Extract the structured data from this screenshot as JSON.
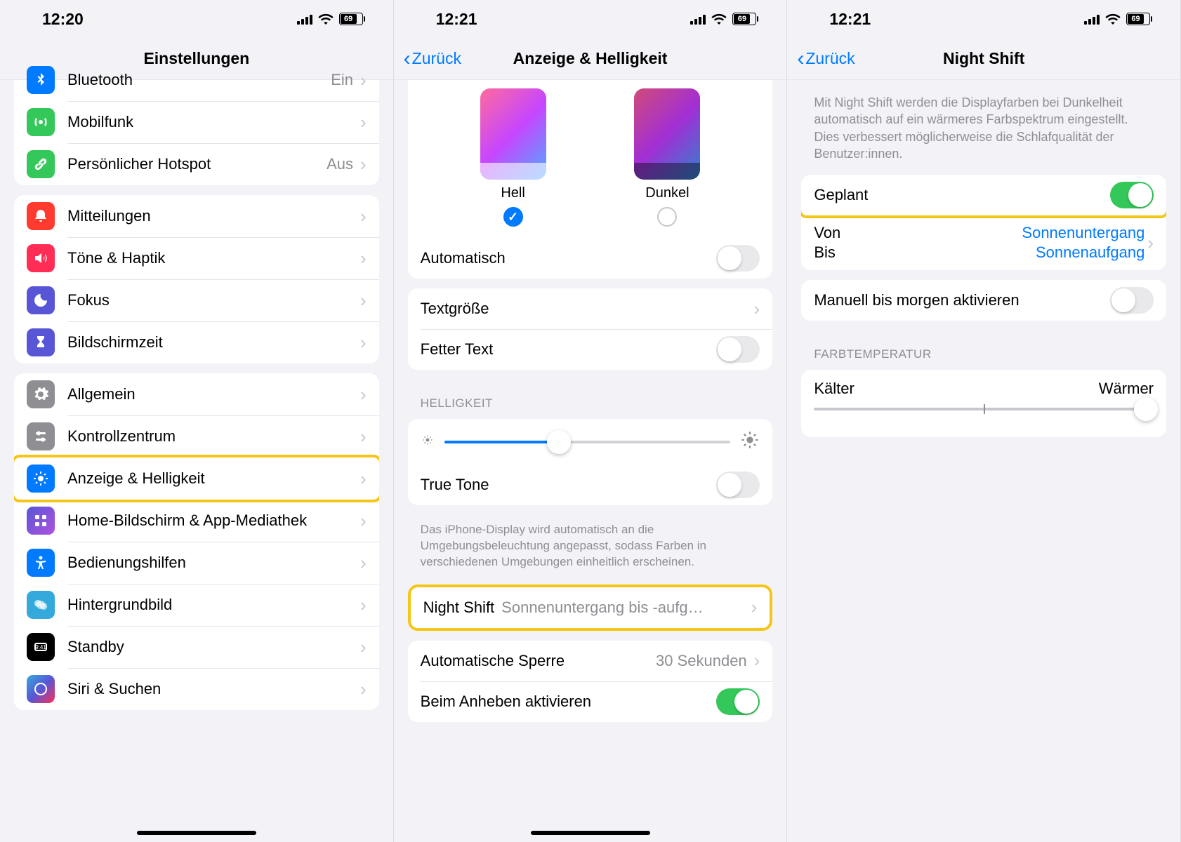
{
  "status": {
    "battery_pct": "69"
  },
  "screen1": {
    "time": "12:20",
    "title": "Einstellungen",
    "rows": {
      "bluetooth": {
        "label": "Bluetooth",
        "value": "Ein"
      },
      "mobilfunk": {
        "label": "Mobilfunk"
      },
      "hotspot": {
        "label": "Persönlicher Hotspot",
        "value": "Aus"
      },
      "mitteilungen": {
        "label": "Mitteilungen"
      },
      "toene": {
        "label": "Töne & Haptik"
      },
      "fokus": {
        "label": "Fokus"
      },
      "bildschirmzeit": {
        "label": "Bildschirmzeit"
      },
      "allgemein": {
        "label": "Allgemein"
      },
      "kontrollzentrum": {
        "label": "Kontrollzentrum"
      },
      "anzeige": {
        "label": "Anzeige & Helligkeit"
      },
      "homescreen": {
        "label": "Home-Bildschirm & App-Mediathek"
      },
      "bedienung": {
        "label": "Bedienungshilfen"
      },
      "hintergrund": {
        "label": "Hintergrundbild"
      },
      "standby": {
        "label": "Standby"
      },
      "siri": {
        "label": "Siri & Suchen"
      }
    }
  },
  "screen2": {
    "time": "12:21",
    "back": "Zurück",
    "title": "Anzeige & Helligkeit",
    "light_label": "Hell",
    "dark_label": "Dunkel",
    "automatisch": "Automatisch",
    "textgroesse": "Textgröße",
    "fettertext": "Fetter Text",
    "helligkeit_header": "HELLIGKEIT",
    "truetone": "True Tone",
    "truetone_desc": "Das iPhone-Display wird automatisch an die Umgebungsbeleuchtung angepasst, sodass Farben in verschiedenen Umgebungen einheitlich erscheinen.",
    "nightshift": "Night Shift",
    "nightshift_value": "Sonnenuntergang bis -aufg…",
    "autosperre": "Automatische Sperre",
    "autosperre_value": "30 Sekunden",
    "anheben": "Beim Anheben aktivieren"
  },
  "screen3": {
    "time": "12:21",
    "back": "Zurück",
    "title": "Night Shift",
    "description": "Mit Night Shift werden die Displayfarben bei Dunkelheit automatisch auf ein wärmeres Farb­spektrum eingestellt. Dies verbessert möglicherweise die Schlafqualität der Benutzer:innen.",
    "geplant": "Geplant",
    "von": "Von",
    "bis": "Bis",
    "sunset": "Sonnenuntergang",
    "sunrise": "Sonnenaufgang",
    "manuell": "Manuell bis morgen aktivieren",
    "temp_header": "FARBTEMPERATUR",
    "cooler": "Kälter",
    "warmer": "Wärmer"
  }
}
